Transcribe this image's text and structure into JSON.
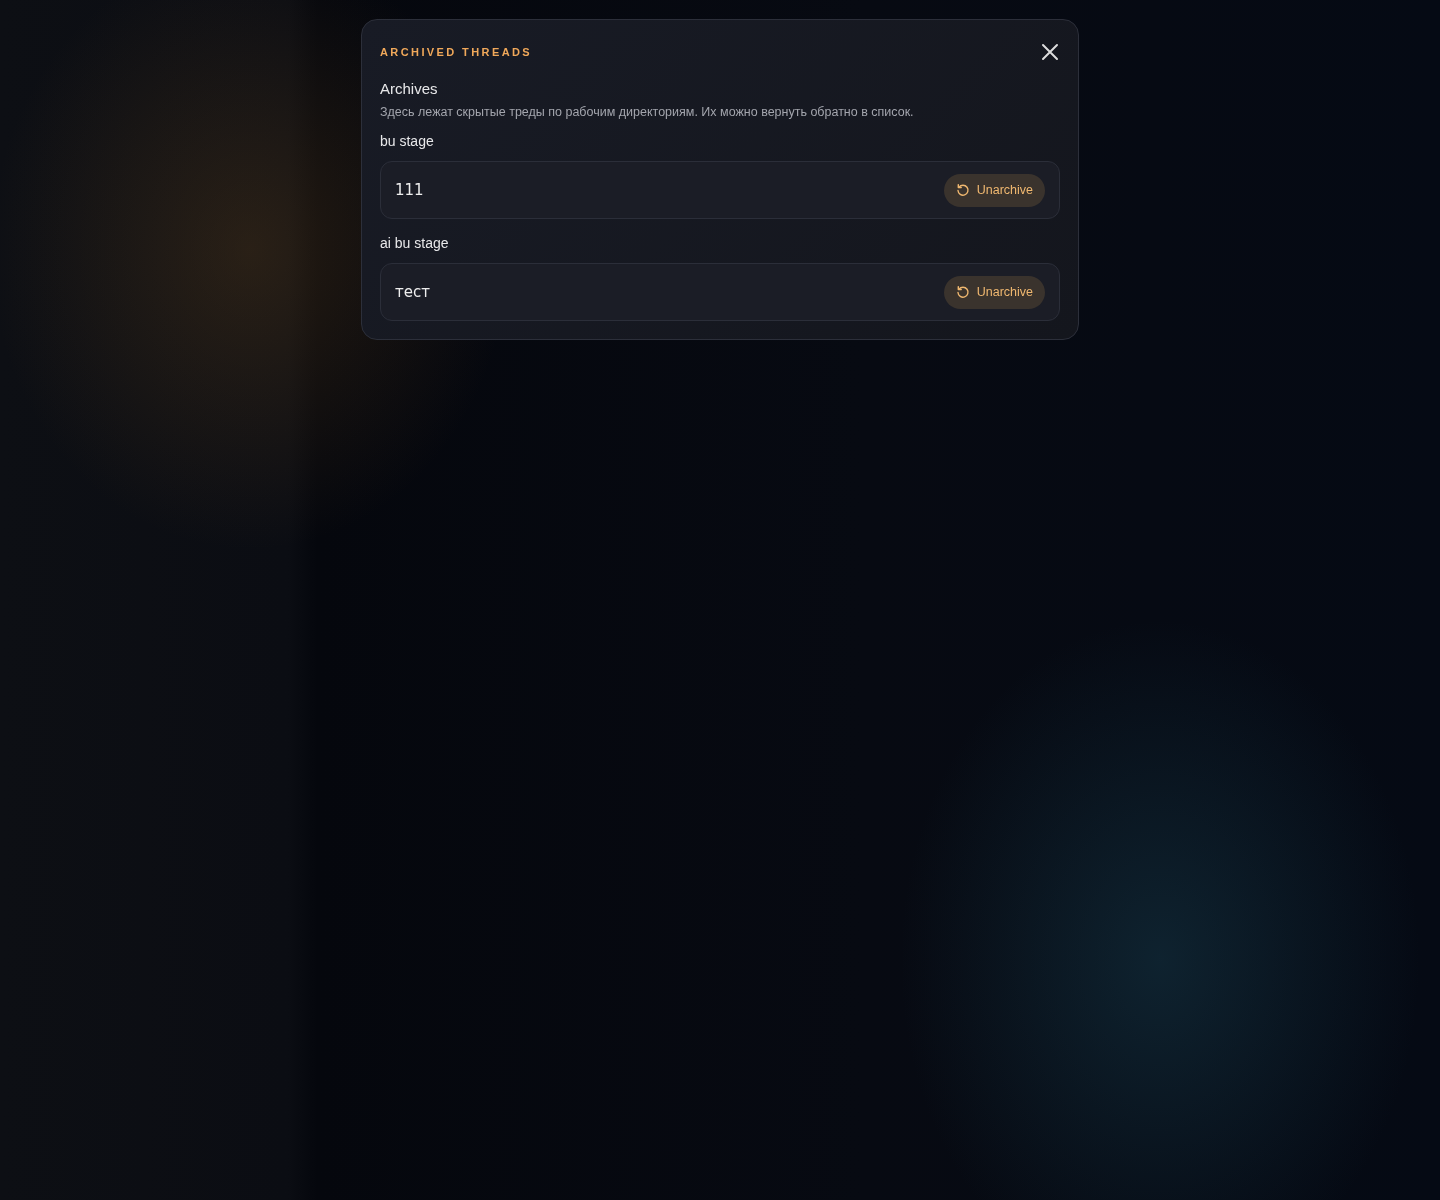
{
  "dialog": {
    "eyebrow": "ARCHIVED THREADS",
    "title": "Archives",
    "description": "Здесь лежат скрытые треды по рабочим директориям. Их можно вернуть обратно в список.",
    "groups": [
      {
        "directory": "bu stage",
        "threads": [
          {
            "title": "111",
            "action": "Unarchive"
          }
        ]
      },
      {
        "directory": "ai bu stage",
        "threads": [
          {
            "title": "тест",
            "action": "Unarchive"
          }
        ]
      }
    ]
  }
}
